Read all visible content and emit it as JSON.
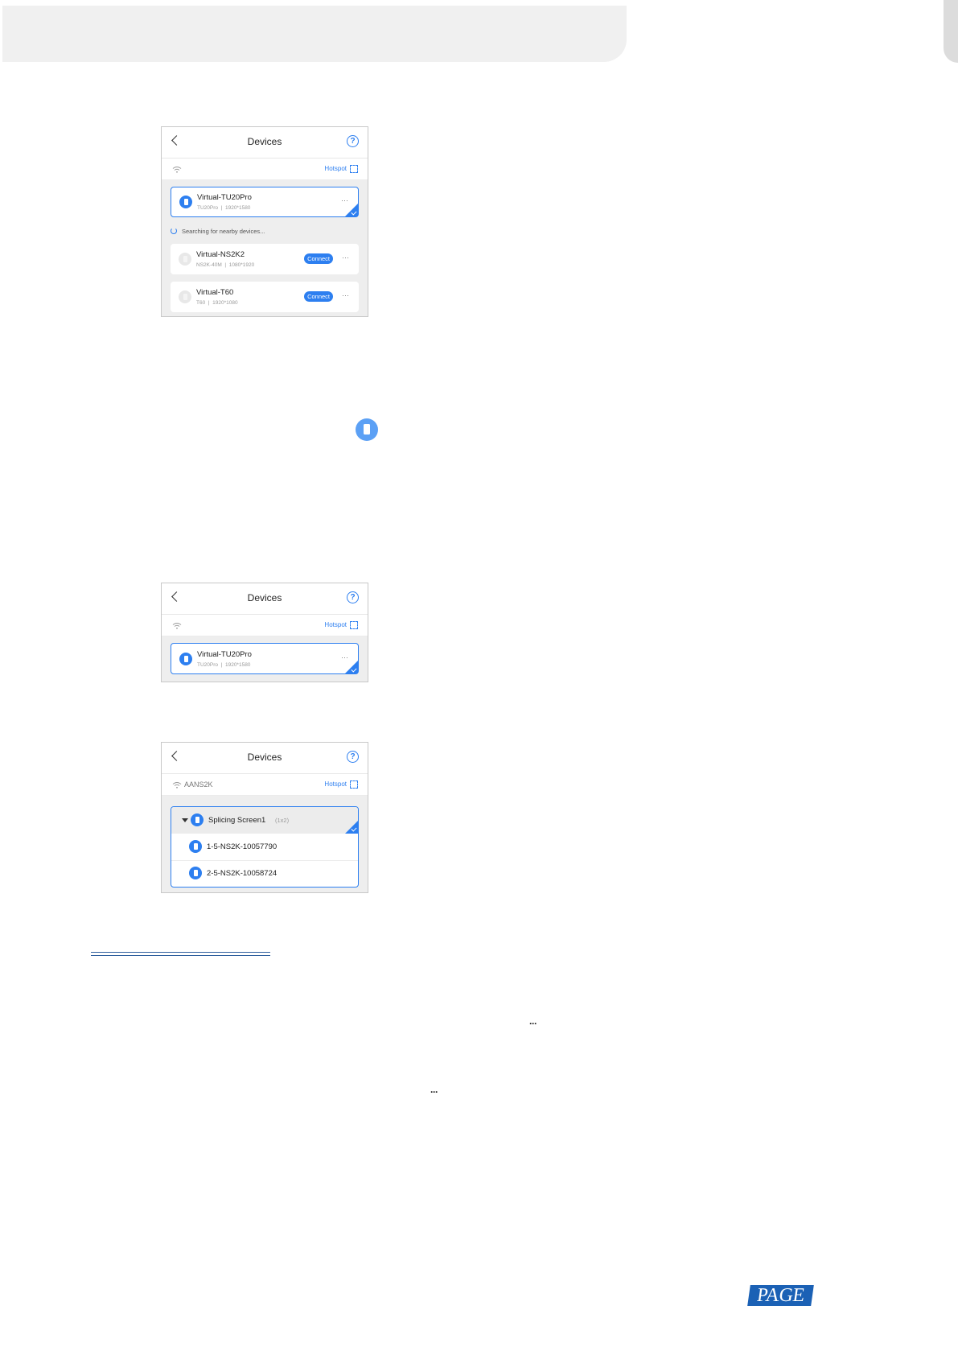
{
  "screens": [
    {
      "title": "Devices",
      "wifi_name": "",
      "hotspot_label": "Hotspot",
      "connected": {
        "name": "Virtual-TU20Pro",
        "model": "TU20Pro",
        "resolution": "1920*1580"
      },
      "searching_text": "Searching for nearby devices...",
      "nearby": [
        {
          "name": "Virtual-NS2K2",
          "model": "NS2K-40M",
          "resolution": "1080*1920",
          "button": "Connect"
        },
        {
          "name": "Virtual-T60",
          "model": "T60",
          "resolution": "1920*1080",
          "button": "Connect"
        }
      ]
    },
    {
      "title": "Devices",
      "wifi_name": "",
      "hotspot_label": "Hotspot",
      "connected": {
        "name": "Virtual-TU20Pro",
        "model": "TU20Pro",
        "resolution": "1920*1580"
      }
    },
    {
      "title": "Devices",
      "wifi_name": "AANS2K",
      "hotspot_label": "Hotspot",
      "group": {
        "name": "Splicing Screen1",
        "size": "(1x2)",
        "members": [
          "1-5-NS2K-10057790",
          "2-5-NS2K-10058724"
        ]
      }
    }
  ],
  "separators": {
    "spec": "|"
  },
  "more_glyph": "···",
  "page_logo": "PAGE"
}
